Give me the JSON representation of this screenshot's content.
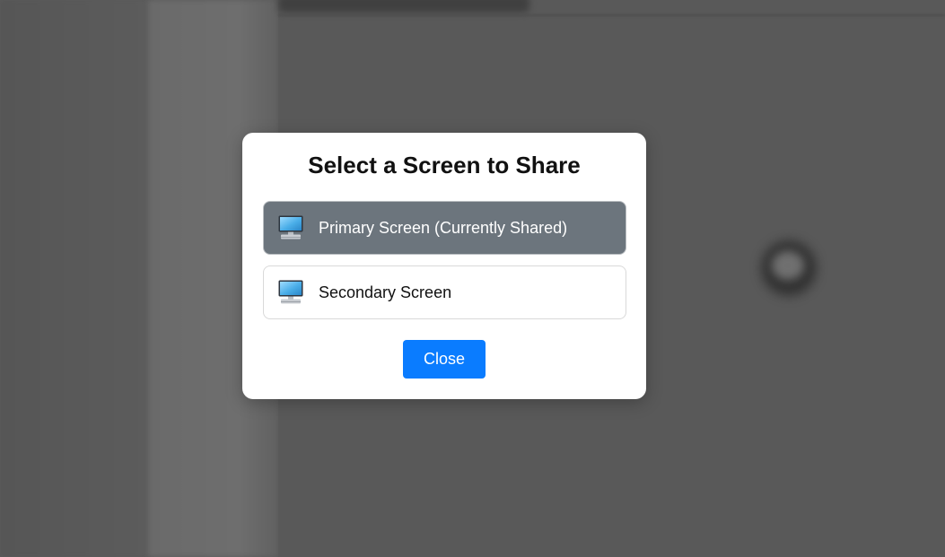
{
  "dialog": {
    "title": "Select a Screen to Share",
    "options": [
      {
        "label": "Primary Screen (Currently Shared)",
        "icon": "desktop-computer-icon",
        "selected": true
      },
      {
        "label": "Secondary Screen",
        "icon": "desktop-computer-icon",
        "selected": false
      }
    ],
    "close_label": "Close"
  },
  "colors": {
    "accent": "#0a7cff",
    "selected_option_bg": "#6c757d",
    "backdrop": "#5a5a5a"
  }
}
